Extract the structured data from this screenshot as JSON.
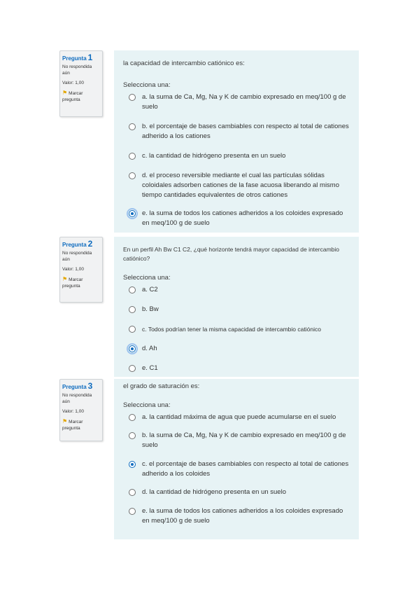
{
  "questions": [
    {
      "label": "Pregunta",
      "number": "1",
      "state": "No respondida aún",
      "grade": "Valor: 1,00",
      "flag": "Marcar pregunta",
      "text": "la capacidad de intercambio catiónico es:",
      "prompt": "Selecciona una:",
      "options": [
        {
          "text": "a. la suma de Ca, Mg, Na y K de cambio expresado en meq/100 g de suelo"
        },
        {
          "text": "b. el porcentaje de bases cambiables con respecto al total de cationes adherido a los cationes"
        },
        {
          "text": "c. la cantidad de hidrógeno presenta en un suelo"
        },
        {
          "text": "d. el proceso reversible mediante el cual las partículas sólidas coloidales adsorben cationes de la fase acuosa liberando al mismo tiempo cantidades equivalentes de otros cationes"
        },
        {
          "text": "e. la suma de todos los cationes adheridos a los coloides expresado en meq/100 g de suelo"
        }
      ],
      "selected": 4
    },
    {
      "label": "Pregunta",
      "number": "2",
      "state": "No respondida aún",
      "grade": "Valor: 1,00",
      "flag": "Marcar pregunta",
      "text": "En un perfil Ah Bw C1 C2, ¿qué horizonte tendrá mayor capacidad de intercambio catiónico?",
      "prompt": "Selecciona una:",
      "options": [
        {
          "text": "a. C2"
        },
        {
          "text": "b. Bw"
        },
        {
          "text": "c. Todos podrían tener la misma capacidad de intercambio catiónico"
        },
        {
          "text": "d. Ah"
        },
        {
          "text": "e. C1"
        }
      ],
      "selected": 3
    },
    {
      "label": "Pregunta",
      "number": "3",
      "state": "No respondida aún",
      "grade": "Valor: 1,00",
      "flag": "Marcar pregunta",
      "text": "el grado de saturación es:",
      "prompt": "Selecciona una:",
      "options": [
        {
          "text": "a. la cantidad máxima de agua que puede acumularse en el suelo"
        },
        {
          "text": "b. la suma de Ca, Mg, Na y K de cambio expresado en meq/100 g de suelo"
        },
        {
          "text": "c. el porcentaje de bases cambiables con respecto al total de cationes adherido a los coloides"
        },
        {
          "text": "d. la cantidad de hidrógeno presenta en un suelo"
        },
        {
          "text": "e. la suma de todos los cationes adheridos a los coloides expresado en meq/100 g de suelo"
        }
      ],
      "selected": 2
    }
  ],
  "colors": {
    "accent": "#0f6cbf",
    "panel": "#e7f3f5",
    "info": "#f1f2f3",
    "flag": "#e3a600"
  }
}
